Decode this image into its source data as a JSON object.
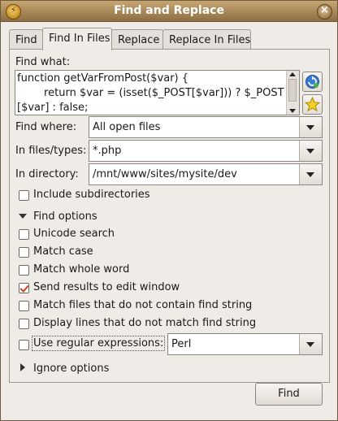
{
  "window": {
    "title": "Find and Replace",
    "close_glyph": "×"
  },
  "tabs": [
    "Find",
    "Find In Files",
    "Replace",
    "Replace In Files"
  ],
  "active_tab": "Find In Files",
  "find_what": {
    "label": "Find what:",
    "value_line1": "function getVarFromPost($var) {",
    "value_line2": "        return $var = (isset($_POST[$var])) ? $_POST",
    "value_line3": "[$var] : false;"
  },
  "side_buttons": {
    "history_icon": "history-refresh-icon",
    "bookmark_icon": "star-icon"
  },
  "find_where": {
    "label": "Find where:",
    "value": "All open files"
  },
  "file_types": {
    "label": "In files/types:",
    "value": "*.php"
  },
  "directory": {
    "label": "In directory:",
    "value": "/mnt/www/sites/mysite/dev"
  },
  "include_subdirectories": {
    "label": "Include subdirectories",
    "checked": false
  },
  "find_options": {
    "label": "Find options",
    "expanded": true,
    "items": [
      {
        "label": "Unicode search",
        "checked": false
      },
      {
        "label": "Match case",
        "checked": false
      },
      {
        "label": "Match whole word",
        "checked": false
      },
      {
        "label": "Send results to edit window",
        "checked": true
      },
      {
        "label": "Match files that do not contain find string",
        "checked": false
      },
      {
        "label": "Display lines that do not match find string",
        "checked": false
      }
    ],
    "regex": {
      "label": "Use regular expressions:",
      "checked": false,
      "engine": "Perl"
    }
  },
  "ignore_options": {
    "label": "Ignore options",
    "expanded": false
  },
  "find_button": {
    "label": "Find"
  },
  "colors": {
    "titlebar": "#a98a5a",
    "check_mark": "#c4431a",
    "panel": "#efebe7"
  }
}
